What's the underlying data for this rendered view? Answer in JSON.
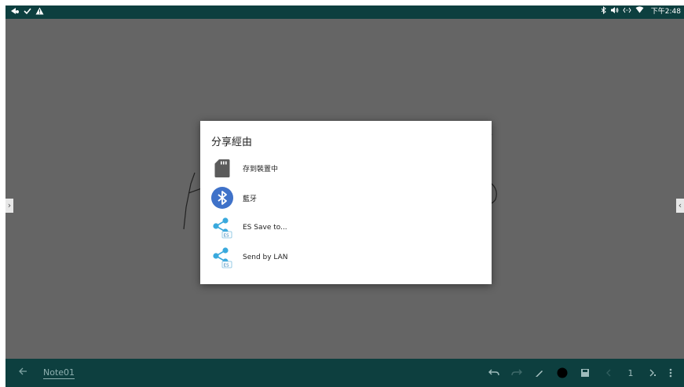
{
  "status_bar": {
    "left_icons": [
      "notification-icon",
      "check-icon",
      "warning-icon"
    ],
    "right_icons": [
      "bluetooth-icon",
      "volume-icon",
      "data-transfer-icon",
      "wifi-icon"
    ],
    "time": "下午2:48"
  },
  "share_dialog": {
    "title": "分享經由",
    "options": [
      {
        "label": "存到裝置中",
        "icon": "sd-card-icon"
      },
      {
        "label": "藍牙",
        "icon": "bluetooth-icon"
      },
      {
        "label": "ES Save to...",
        "icon": "es-share-icon"
      },
      {
        "label": "Send by LAN",
        "icon": "es-share-icon"
      }
    ]
  },
  "edge_tabs": {
    "left": "›",
    "right": "‹"
  },
  "bottom_bar": {
    "note_title": "Note01",
    "page_number": "1",
    "tools": [
      "back-icon",
      "undo-icon",
      "redo-icon",
      "pen-icon",
      "color-picker-icon",
      "save-icon",
      "previous-page-icon",
      "next-page-icon",
      "more-icon"
    ],
    "colors": {
      "bar": "#0d3f3f",
      "icon": "#7fa3a3",
      "pen_color": "#000000"
    }
  }
}
